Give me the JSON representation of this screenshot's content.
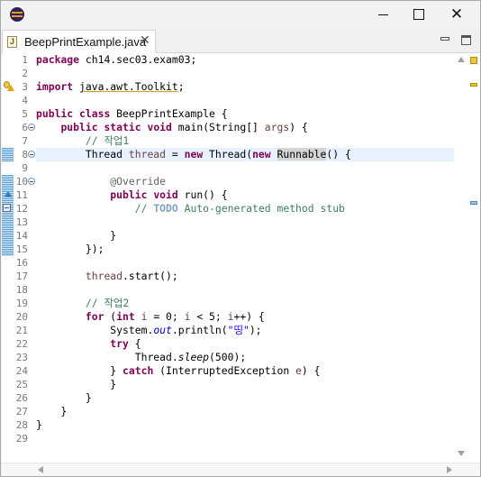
{
  "window": {
    "close_glyph": "✕"
  },
  "editor_tab": {
    "label": "BeepPrintExample.java",
    "close_glyph": "✕"
  },
  "line_numbers": [
    "1",
    "2",
    "3",
    "4",
    "5",
    "6",
    "7",
    "8",
    "9",
    "10",
    "11",
    "12",
    "13",
    "14",
    "15",
    "16",
    "17",
    "18",
    "19",
    "20",
    "21",
    "22",
    "23",
    "24",
    "25",
    "26",
    "27",
    "28",
    "29"
  ],
  "code": {
    "l1_kw": "package",
    "l1_rest": " ch14.sec03.exam03;",
    "l3_kw": "import",
    "l3_pre": " ",
    "l3_imp": "java.awt.Toolkit",
    "l3_post": ";",
    "l5_kw1": "public",
    "l5_sp": " ",
    "l5_kw2": "class",
    "l5_rest": " BeepPrintExample {",
    "l6_ind": "    ",
    "l6_kw1": "public",
    "l6_s1": " ",
    "l6_kw2": "static",
    "l6_s2": " ",
    "l6_kw3": "void",
    "l6_rest": " main(String[] ",
    "l6_var": "args",
    "l6_end": ") {",
    "l7_ind": "        ",
    "l7_cm": "// 작업1",
    "l8_pre": "        Thread ",
    "l8_var": "thread",
    "l8_eq": " = ",
    "l8_kw1": "new",
    "l8_mid": " Thread(",
    "l8_kw2": "new",
    "l8_sp": " ",
    "l8_hl": "Runnable",
    "l8_end": "() {",
    "l10_ind": "            ",
    "l10_an": "@Override",
    "l11_ind": "            ",
    "l11_kw1": "public",
    "l11_sp": " ",
    "l11_kw2": "void",
    "l11_rest": " run() {",
    "l12_ind": "                ",
    "l12_cm1": "// ",
    "l12_todo": "TODO",
    "l12_cm2": " Auto-generated method stub",
    "l14_text": "            }",
    "l15_text": "        });",
    "l17_ind": "        ",
    "l17_var": "thread",
    "l17_rest": ".start();",
    "l19_ind": "        ",
    "l19_cm": "// 작업2",
    "l20_ind": "        ",
    "l20_kw1": "for",
    "l20_a": " (",
    "l20_kw2": "int",
    "l20_b": " ",
    "l20_v1": "i",
    "l20_c": " = 0; ",
    "l20_v2": "i",
    "l20_d": " < 5; ",
    "l20_v3": "i",
    "l20_e": "++) {",
    "l21_pre": "            System.",
    "l21_fld": "out",
    "l21_mid": ".println(",
    "l21_str": "\"띵\"",
    "l21_end": ");",
    "l22_ind": "            ",
    "l22_kw": "try",
    "l22_rest": " {",
    "l23_pre": "                Thread.",
    "l23_mth": "sleep",
    "l23_end": "(500);",
    "l24_pre": "            } ",
    "l24_kw": "catch",
    "l24_mid": " (InterruptedException ",
    "l24_var": "e",
    "l24_end": ") {",
    "l25_text": "            }",
    "l26_text": "        }",
    "l27_text": "    }",
    "l28_text": "}"
  }
}
